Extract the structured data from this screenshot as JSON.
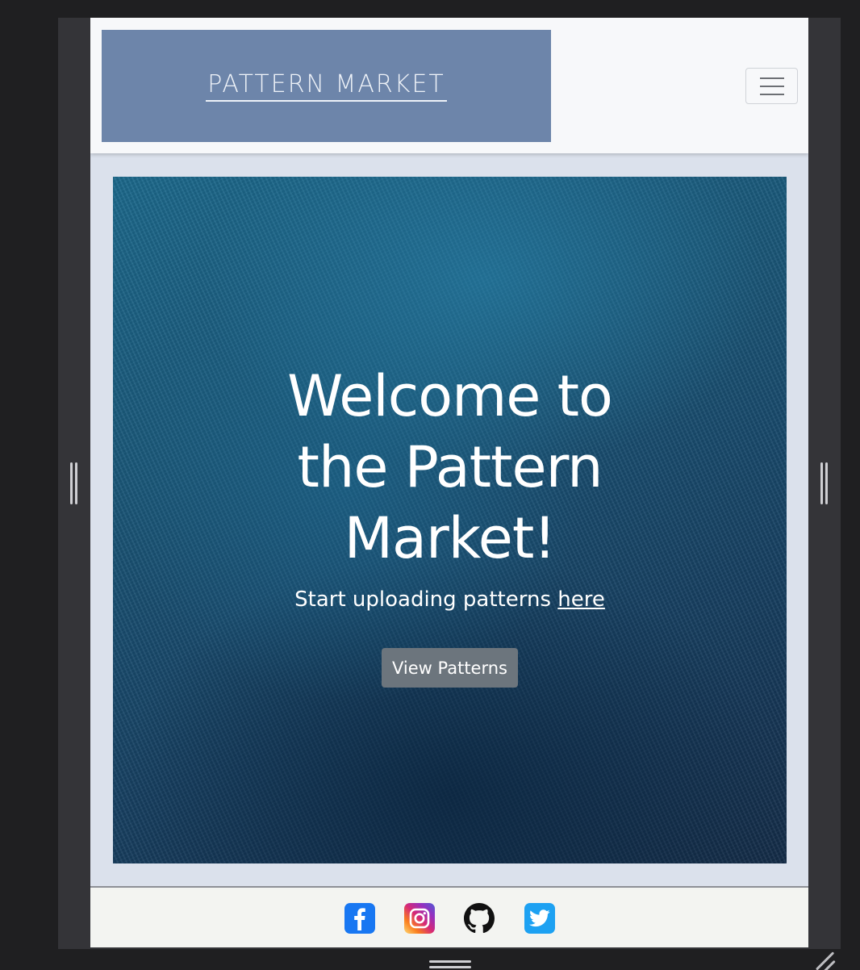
{
  "navbar": {
    "logo_text": "PATTERN MARKET",
    "toggle_label": "Toggle navigation"
  },
  "hero": {
    "title": "Welcome to the Pattern Market!",
    "subtitle_prefix": "Start uploading patterns ",
    "subtitle_link": "here",
    "button_label": "View Patterns"
  },
  "footer": {
    "social_icons": [
      "facebook-icon",
      "instagram-icon",
      "github-icon",
      "twitter-icon"
    ]
  },
  "colors": {
    "logo_background": "#6d85aa",
    "page_background": "#dbe1ec",
    "button_background": "#6c757d",
    "facebook": "#1877f2",
    "twitter": "#1da1f2"
  }
}
